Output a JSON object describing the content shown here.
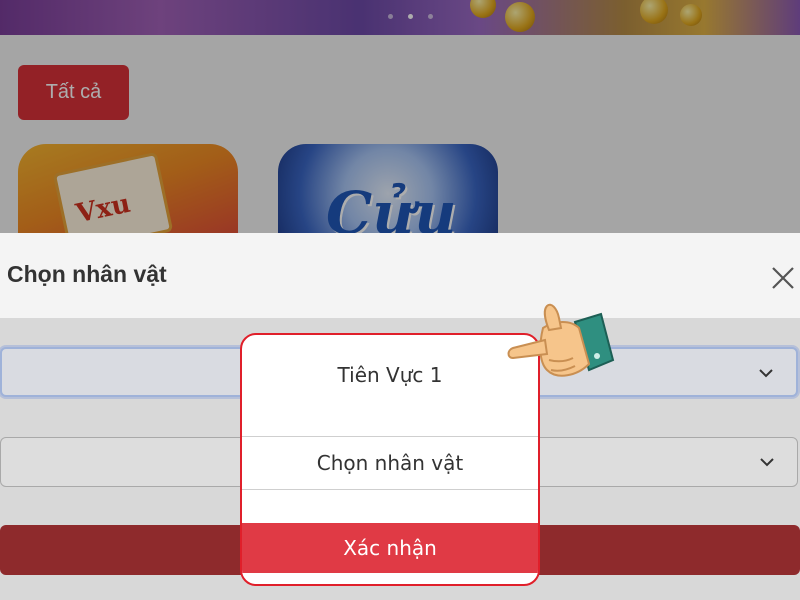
{
  "background": {
    "filter_all_label": "Tất cả",
    "tiles": [
      {
        "name": "Vxu",
        "text": "Vxu"
      },
      {
        "name": "Cửu",
        "text": "Cửu"
      }
    ]
  },
  "modal": {
    "title": "Chọn nhân vật",
    "close_icon": "close-icon",
    "server_select": {
      "value": "Tiên Vực 1"
    },
    "character_select": {
      "placeholder": "Chọn nhân vật"
    },
    "confirm_label": "Xác nhận"
  },
  "colors": {
    "accent_red": "#e03a45",
    "highlight_border": "#e01f2a",
    "filter_button": "#d93139"
  }
}
